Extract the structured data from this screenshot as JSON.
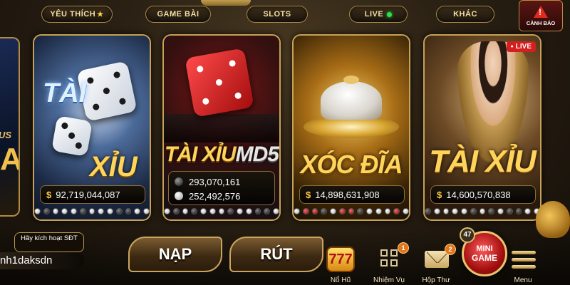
{
  "nav": {
    "tabs": [
      {
        "label": "YÊU THÍCH",
        "icon": "star-icon"
      },
      {
        "label": "GAME BÀI"
      },
      {
        "label": "SLOTS"
      },
      {
        "label": "LIVE",
        "icon": "live-dot-icon"
      },
      {
        "label": "KHÁC"
      }
    ],
    "warning": {
      "icon": "warning-triangle-icon",
      "label": "CẢNH BÁO"
    }
  },
  "left_partial": {
    "text_top": "US",
    "text_big": "A"
  },
  "games": [
    {
      "title_line1": "TÀI",
      "title_line2": "XỈU",
      "jackpot": "92,719,044,087",
      "dots": [
        "w",
        "b",
        "w",
        "w",
        "w",
        "b",
        "w",
        "w",
        "w",
        "b",
        "b",
        "w",
        "w"
      ]
    },
    {
      "title_main": "TÀI XỈU",
      "title_suffix": "MD5",
      "jackpot_black": "293,070,161",
      "jackpot_white": "252,492,576",
      "dots": [
        "w",
        "b",
        "w",
        "b",
        "w",
        "w",
        "w",
        "b",
        "w",
        "w",
        "b",
        "b",
        "w"
      ]
    },
    {
      "title": "XÓC ĐĨA",
      "jackpot": "14,898,631,908",
      "dots": [
        "w",
        "r",
        "r",
        "b",
        "w",
        "r",
        "r",
        "b",
        "w",
        "w",
        "w",
        "r",
        "w"
      ]
    },
    {
      "title": "TÀI XỈU",
      "badge": "LIVE",
      "jackpot": "14,600,570,838",
      "dots": [
        "b",
        "w",
        "w",
        "w",
        "w",
        "b",
        "w",
        "b",
        "w",
        "b",
        "b",
        "w",
        "w"
      ]
    }
  ],
  "account": {
    "activate_label": "Hãy kích hoạt SĐT",
    "username": "nh1daksdn"
  },
  "actions": {
    "deposit": "NẠP",
    "withdraw": "RÚT"
  },
  "bottom": {
    "jackpot_label": "Nổ Hũ",
    "jackpot_icon_text": "777",
    "mission_label": "Nhiệm Vụ",
    "mission_badge": "1",
    "mail_label": "Hộp Thư",
    "mail_badge": "2",
    "mini_game_line1": "MINI",
    "mini_game_line2": "GAME",
    "mini_game_count": "47",
    "menu_label": "Menu"
  },
  "colors": {
    "gold": "#c7a156",
    "accent_gold": "#ffd45a",
    "live_red": "#d21f1f",
    "live_green": "#29e04d"
  }
}
